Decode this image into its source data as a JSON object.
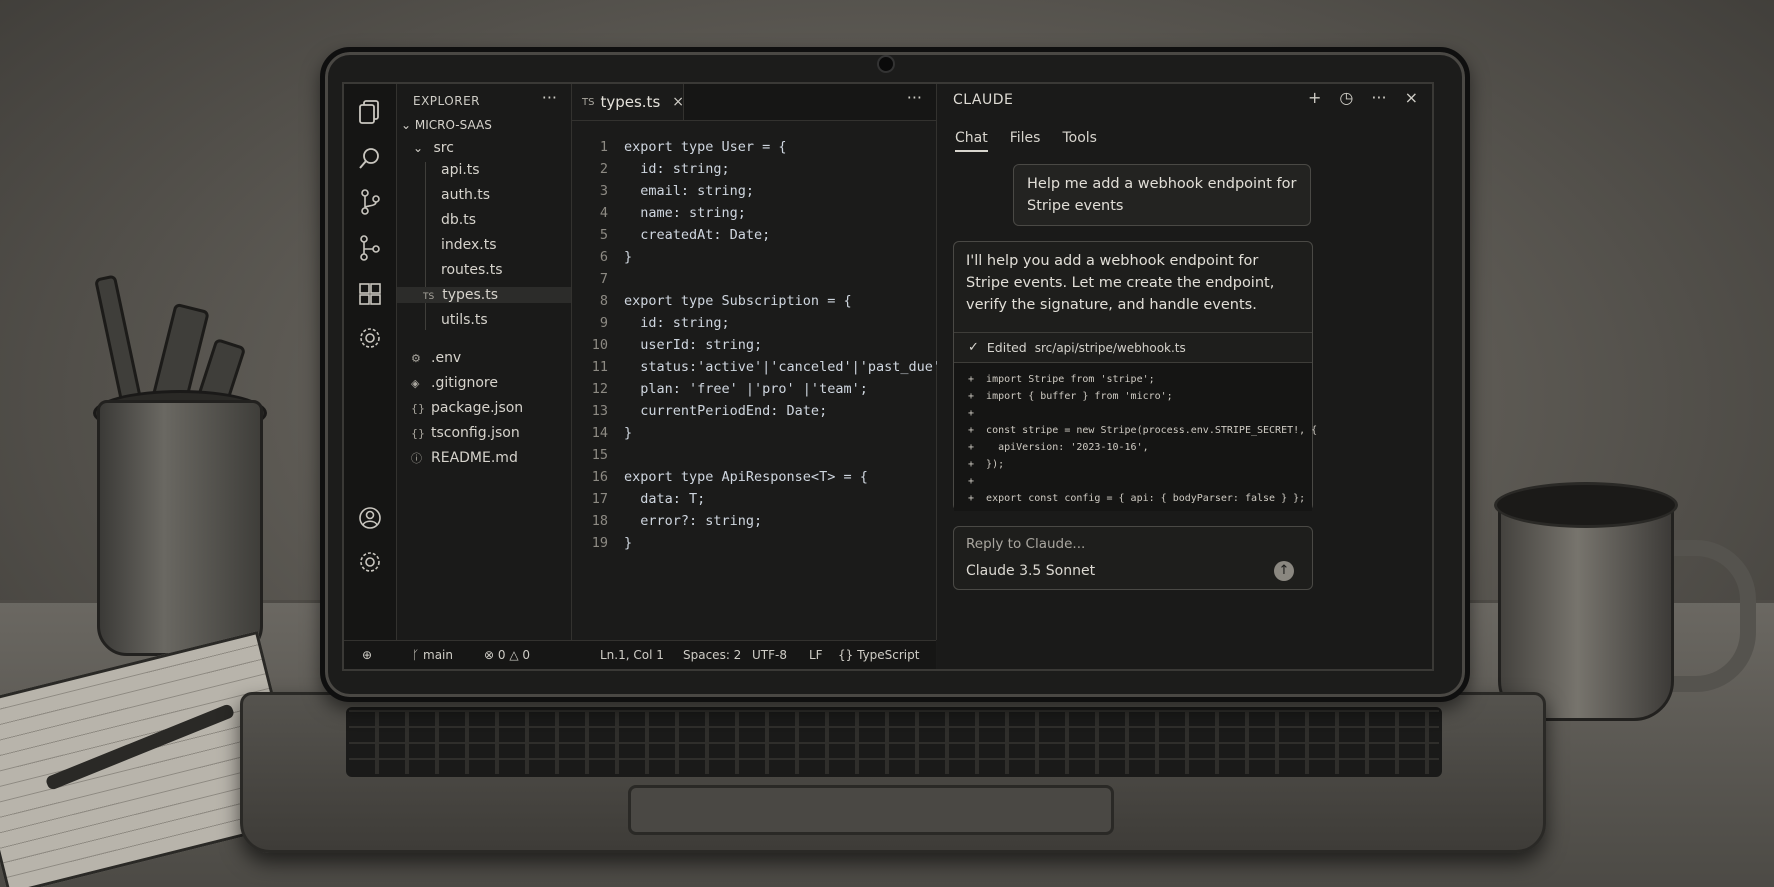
{
  "activity_bar": {
    "icons": [
      "files-icon",
      "search-icon",
      "source-control-icon",
      "git-branch-icon",
      "extensions-icon",
      "settings-icon"
    ],
    "bottom_icons": [
      "account-icon",
      "manage-gear-icon"
    ]
  },
  "explorer": {
    "title": "EXPLORER",
    "more": "···",
    "root": "MICRO-SAAS",
    "src_folder": "src",
    "src_files": [
      "api.ts",
      "auth.ts",
      "db.ts",
      "index.ts",
      "routes.ts",
      "types.ts",
      "utils.ts"
    ],
    "selected_badge": "TS",
    "root_files": [
      ".env",
      ".gitignore",
      "package.json",
      "tsconfig.json",
      "README.md"
    ]
  },
  "editor": {
    "tab_lang": "TS",
    "tab_name": "types.ts",
    "tab_close": "×",
    "more": "···",
    "lines": [
      "export type User = {",
      "  id: string;",
      "  email: string;",
      "  name: string;",
      "  createdAt: Date;",
      "}",
      "",
      "export type Subscription = {",
      "  id: string;",
      "  userId: string;",
      "  status:'active'|'canceled'|'past_due';",
      "  plan: 'free' |'pro' |'team';",
      "  currentPeriodEnd: Date;",
      "}",
      "",
      "export type ApiResponse<T> = {",
      "  data: T;",
      "  error?: string;",
      "}"
    ],
    "line_numbers": [
      "1",
      "2",
      "3",
      "4",
      "5",
      "6",
      "7",
      "8",
      "9",
      "10",
      "11",
      "12",
      "13",
      "14",
      "15",
      "16",
      "17",
      "18",
      "19"
    ]
  },
  "statusbar": {
    "branch": "main",
    "problems": "⊗ 0 △ 0",
    "position": "Ln.1, Col 1",
    "spaces": "Spaces: 2",
    "encoding": "UTF-8",
    "eol": "LF",
    "language": "{} TypeScript"
  },
  "claude": {
    "title": "CLAUDE",
    "actions": [
      "+",
      "◷",
      "···",
      "×"
    ],
    "tabs": [
      "Chat",
      "Files",
      "Tools"
    ],
    "user_message": "Help me add a webhook endpoint for Stripe events",
    "assistant_message": "I'll help you add a webhook endpoint for Stripe events. Let me create the endpoint, verify the signature, and handle events.",
    "edit_label": "Edited",
    "edit_path": "src/api/stripe/webhook.ts",
    "diff_lines": [
      "+  import Stripe from 'stripe';",
      "+  import { buffer } from 'micro';",
      "+",
      "+  const stripe = new Stripe(process.env.STRIPE_SECRET!, {",
      "+    apiVersion: '2023-10-16',",
      "+  });",
      "+",
      "+  export const config = { api: { bodyParser: false } };"
    ],
    "reply_placeholder": "Reply to Claude...",
    "model": "Claude 3.5 Sonnet",
    "send_icon": "↑"
  }
}
